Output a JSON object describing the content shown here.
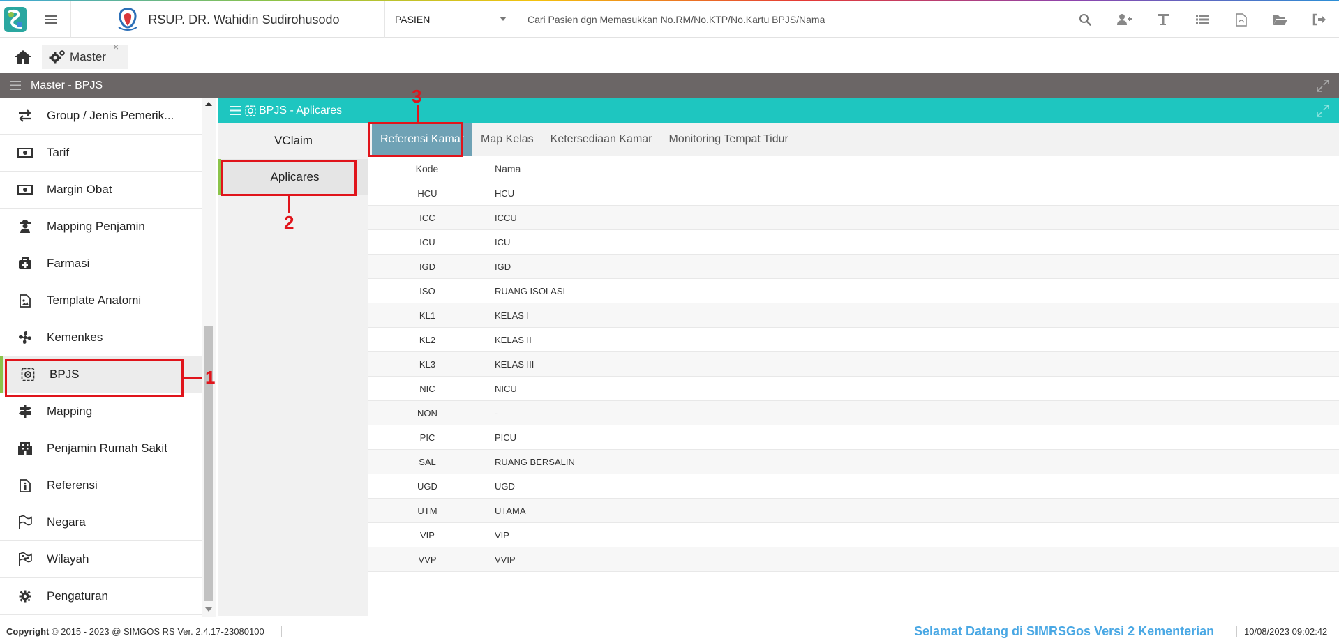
{
  "header": {
    "hospital_name": "RSUP. DR. Wahidin Sudirohusodo",
    "patient_select": "PASIEN",
    "search_placeholder": "Cari Pasien dgn Memasukkan No.RM/No.KTP/No.Kartu BPJS/Nama",
    "icons": [
      "search-icon",
      "add-user-icon",
      "text-icon",
      "list-icon",
      "pdf-icon",
      "folder-open-icon",
      "logout-icon"
    ]
  },
  "tabs": {
    "master_label": "Master",
    "close": "×"
  },
  "module": {
    "title": "Master - BPJS"
  },
  "sidebar": {
    "items": [
      {
        "label": "Group / Jenis Pemerik...",
        "icon": "exchange-icon"
      },
      {
        "label": "Tarif",
        "icon": "money-icon"
      },
      {
        "label": "Margin Obat",
        "icon": "money-icon"
      },
      {
        "label": "Mapping Penjamin",
        "icon": "user-secret-icon"
      },
      {
        "label": "Farmasi",
        "icon": "medkit-icon"
      },
      {
        "label": "Template Anatomi",
        "icon": "image-icon"
      },
      {
        "label": "Kemenkes",
        "icon": "fan-icon"
      },
      {
        "label": "BPJS",
        "icon": "settings-icon"
      },
      {
        "label": "Mapping",
        "icon": "signpost-icon"
      },
      {
        "label": "Penjamin Rumah Sakit",
        "icon": "building-icon"
      },
      {
        "label": "Referensi",
        "icon": "document-icon"
      },
      {
        "label": "Negara",
        "icon": "flag-icon"
      },
      {
        "label": "Wilayah",
        "icon": "checkered-flag-icon"
      },
      {
        "label": "Pengaturan",
        "icon": "gear-icon"
      }
    ]
  },
  "panel": {
    "title": "BPJS - Aplicares",
    "vertical_tabs": [
      "VClaim",
      "Aplicares"
    ],
    "horizontal_tabs": [
      "Referensi Kamar",
      "Map Kelas",
      "Ketersediaan Kamar",
      "Monitoring Tempat Tidur"
    ]
  },
  "grid": {
    "columns": [
      "Kode",
      "Nama"
    ],
    "rows": [
      [
        "HCU",
        "HCU"
      ],
      [
        "ICC",
        "ICCU"
      ],
      [
        "ICU",
        "ICU"
      ],
      [
        "IGD",
        "IGD"
      ],
      [
        "ISO",
        "RUANG ISOLASI"
      ],
      [
        "KL1",
        "KELAS I"
      ],
      [
        "KL2",
        "KELAS II"
      ],
      [
        "KL3",
        "KELAS III"
      ],
      [
        "NIC",
        "NICU"
      ],
      [
        "NON",
        "-"
      ],
      [
        "PIC",
        "PICU"
      ],
      [
        "SAL",
        "RUANG BERSALIN"
      ],
      [
        "UGD",
        "UGD"
      ],
      [
        "UTM",
        "UTAMA"
      ],
      [
        "VIP",
        "VIP"
      ],
      [
        "VVP",
        "VVIP"
      ]
    ]
  },
  "footer": {
    "copyright_bold": "Copyright",
    "copyright_text": "2015 - 2023 @ SIMGOS RS Ver. 2.4.17-23080100",
    "marquee": "Selamat Datang di SIMRSGos Versi 2 Kementerian",
    "datetime": "10/08/2023 09:02:42"
  },
  "annotations": [
    "1",
    "2",
    "3"
  ],
  "colors": {
    "panel_header": "#1ec6c0",
    "module_bar": "#6b6666",
    "active_htab": "#6fa2b5",
    "annotation": "#e0141b",
    "active_accent": "#8bc34a"
  }
}
